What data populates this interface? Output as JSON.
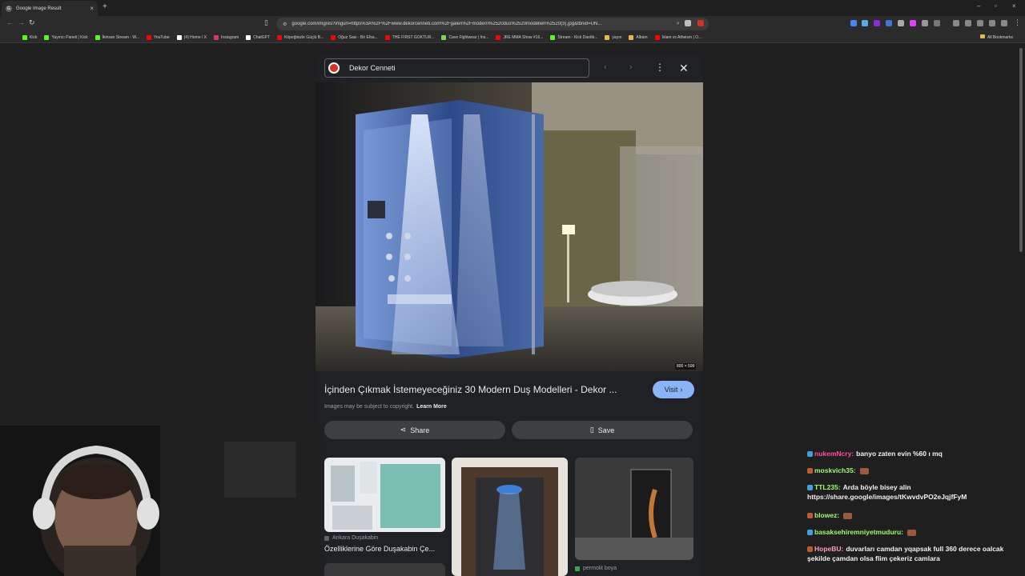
{
  "browser": {
    "tab_title": "Google Image Result",
    "new_tab_glyph": "+",
    "url": "google.com/imgres?imgurl=https%3A%2F%2Fwww.dekorcenneti.com%2Fgaleri%2Fmodern%2520dus%2520modelleri%2520(3).jpg&tbnid=UN...",
    "bookmarks": [
      "Kick",
      "Yayıncı Paneli | Kick",
      "İkinsan Stream - W...",
      "YouTube",
      "(4) Home / X",
      "Instagram",
      "ChatGPT",
      "Köpeğinizle Güçlü B...",
      "Oğuz Sası - Bir Efsa...",
      "THE FIRST GOKTUR...",
      "Cave Fightwear | Ins...",
      "JRE MMA Show #16...",
      "Stream - Kick Dashb...",
      "yayın",
      "Albüm",
      "İslam vs Atheism | O..."
    ],
    "bookmark_colors": [
      "#53fc18",
      "#53fc18",
      "#53fc18",
      "#ff0000",
      "#ffffff",
      "#e1306c",
      "#ffffff",
      "#ff0000",
      "#ff0000",
      "#ff0000",
      "#7dd35b",
      "#ff0000",
      "#53fc18",
      "#e7b848",
      "#e7b848",
      "#ff0000"
    ],
    "all_bookmarks": "All Bookmarks"
  },
  "viewer": {
    "source_name": "Dekor Cenneti",
    "image_dims": "800 × 599",
    "title": "İçinden Çıkmak İstemeyeceğiniz 30 Modern Duş Modelleri - Dekor ...",
    "visit_label": "Visit",
    "copyright_text": "Images may be subject to copyright.",
    "learn_more": "Learn More",
    "share_label": "Share",
    "save_label": "Save",
    "related": [
      {
        "source": "Ankara Duşakabin",
        "caption": "Özelliklerine Göre Duşakabin Çe..."
      },
      {
        "source": "",
        "caption": ""
      },
      {
        "source": "permolit boya",
        "caption": ""
      }
    ]
  },
  "chat": [
    {
      "user": "nukemNcry:",
      "color": "#ff4fa0",
      "text": "banyo zaten evin %60 ı mq"
    },
    {
      "user": "moskvich35:",
      "color": "#9dff6e",
      "text": ""
    },
    {
      "user": "TTL235:",
      "color": "#9dff6e",
      "text": "Arda böyle bisey alin https://share.google/images/tKwvdvPO2eJqjfFyM"
    },
    {
      "user": "blowez:",
      "color": "#9dff6e",
      "text": ""
    },
    {
      "user": "basaksehiremniyetmuduru:",
      "color": "#9dff6e",
      "text": ""
    },
    {
      "user": "HopeBU:",
      "color": "#ff9db8",
      "text": "duvarları camdan yqapsak full 360 derece oalcak şekilde çamdan olsa flim çekeriz camlara"
    }
  ]
}
